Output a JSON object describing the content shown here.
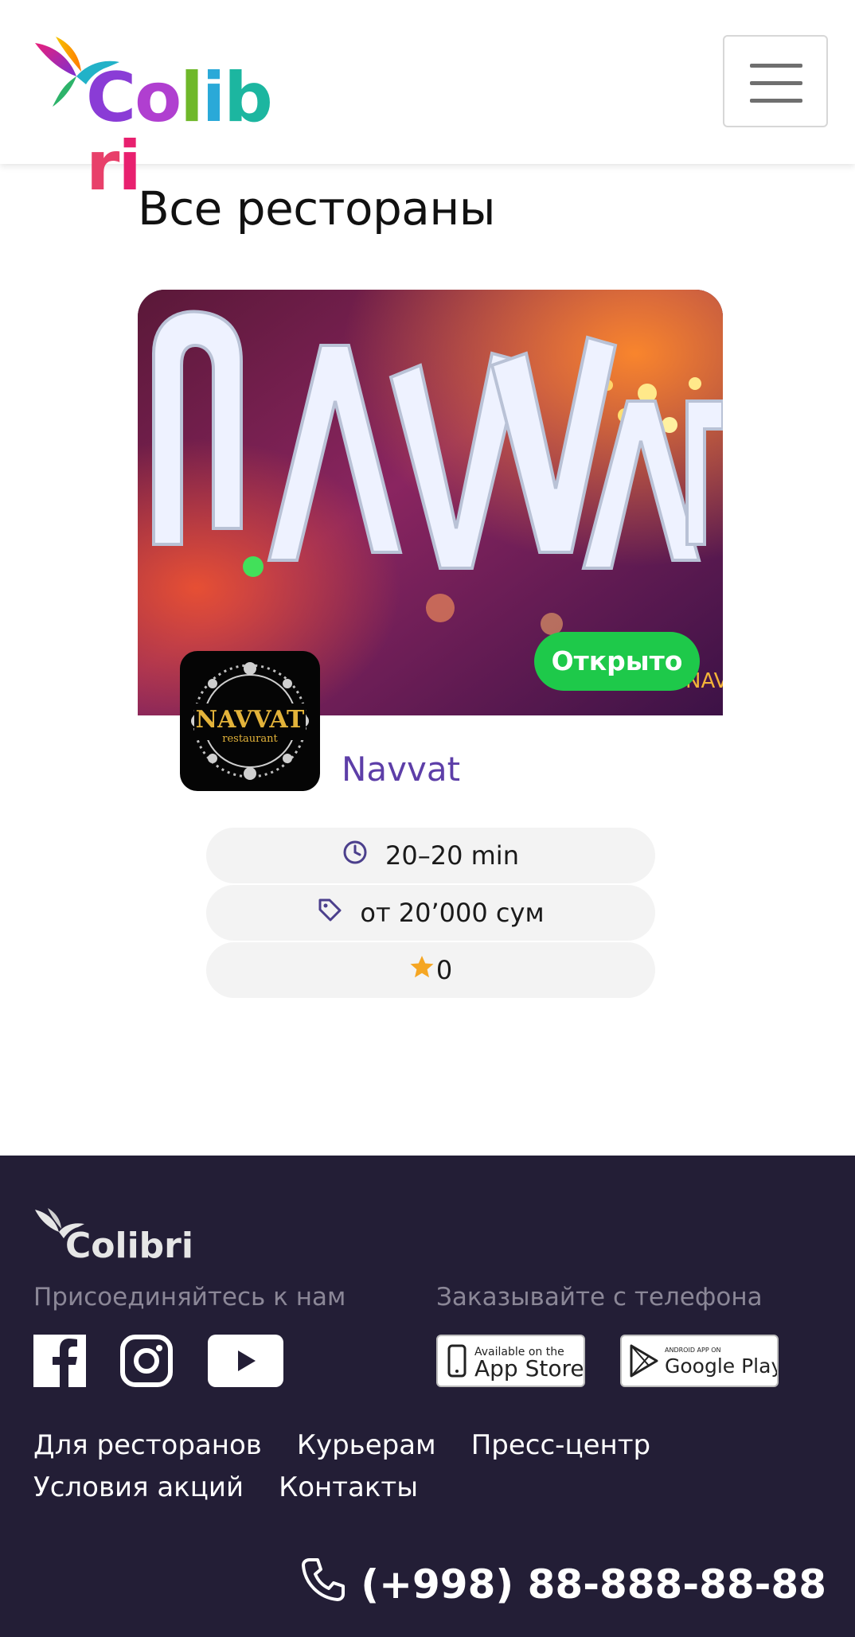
{
  "header": {
    "logo_text": "Colibri",
    "menu_icon": "hamburger-icon"
  },
  "main": {
    "title": "Все рестораны",
    "restaurant": {
      "hero_sign_text": "NAVVAT",
      "status": "Открыто",
      "logo_text_top": "NAVVAT",
      "logo_text_bottom": "restaurant",
      "name": "Navvat",
      "delivery_time": "20–20 min",
      "min_price": "от 20’000 сум",
      "rating": "0",
      "icons": {
        "time": "clock-icon",
        "price": "price-tag-icon",
        "rating": "star-icon"
      },
      "colors": {
        "status_bg": "#1ec94a",
        "name": "#5d3ea8",
        "star": "#f5a623"
      }
    }
  },
  "footer": {
    "logo_text": "Colibri",
    "join_heading": "Присоединяйтесь к нам",
    "order_heading": "Заказывайте с телефона",
    "social": [
      "facebook-icon",
      "instagram-icon",
      "youtube-icon"
    ],
    "app_store": {
      "small": "Available on the",
      "big": "App Store"
    },
    "google_play": {
      "small": "ANDROID APP ON",
      "big": "Google Play"
    },
    "links_row1": [
      "Для ресторанов",
      "Курьерам",
      "Пресс-центр"
    ],
    "links_row2": [
      "Условия акций",
      "Контакты"
    ],
    "phone": "(+998) 88-888-88-88",
    "colors": {
      "bg": "#231e36",
      "muted": "#8b8797"
    }
  }
}
